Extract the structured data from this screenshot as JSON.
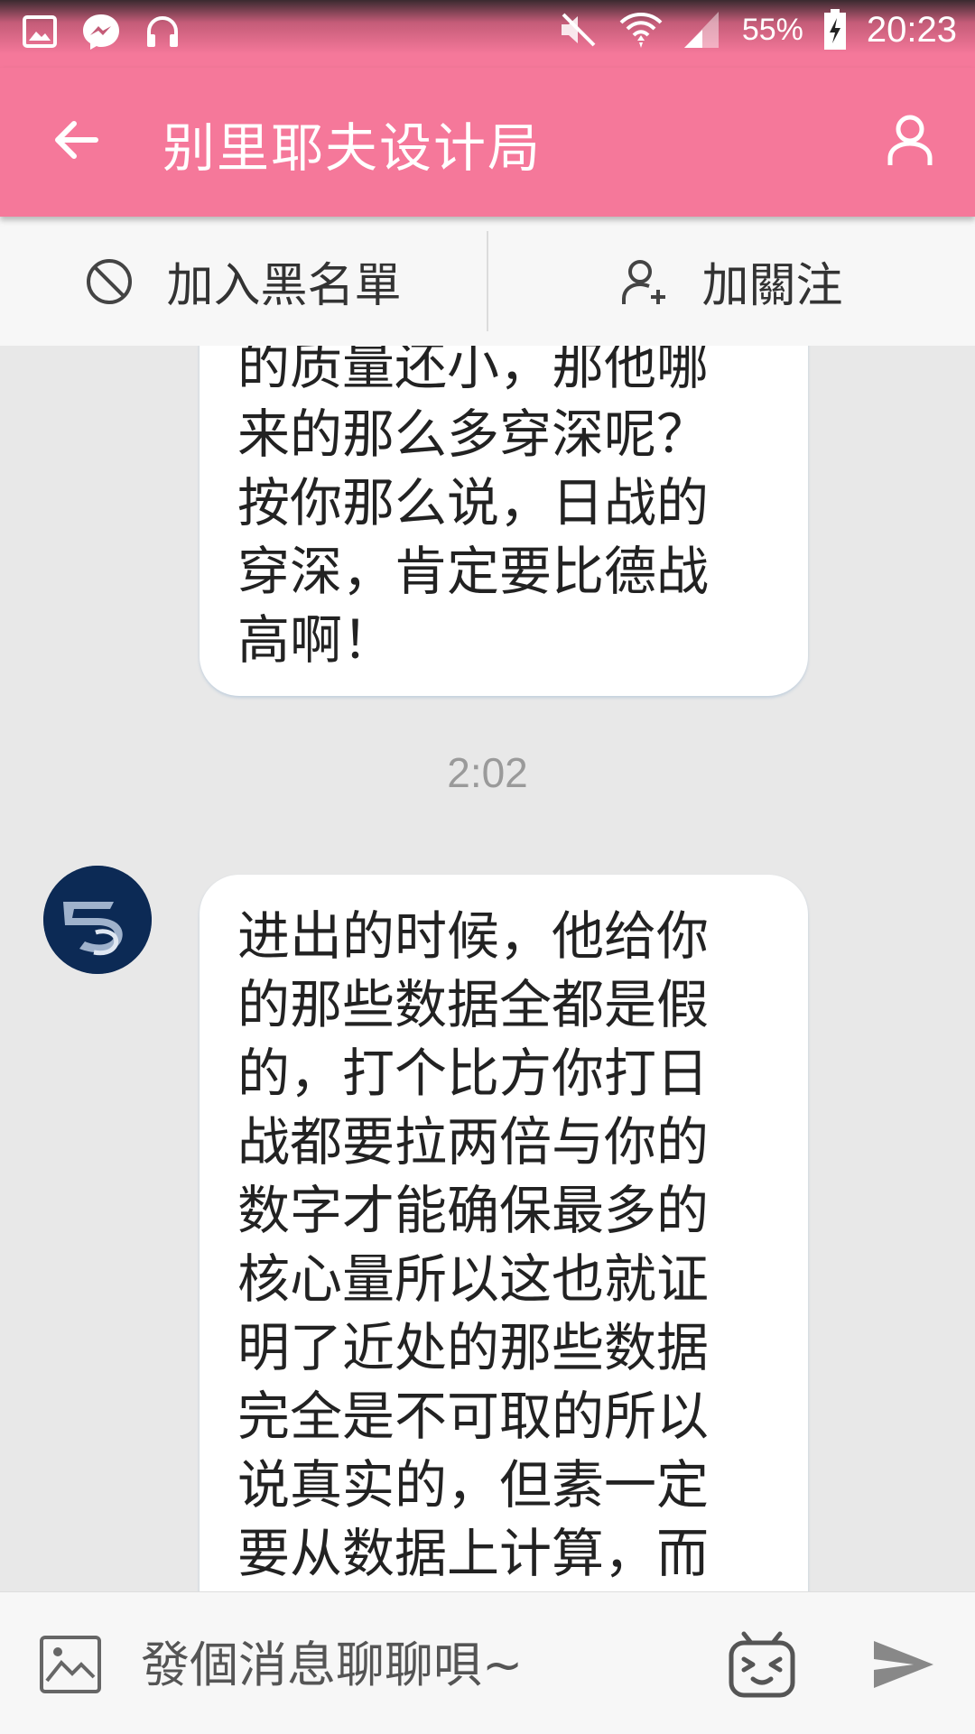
{
  "status_bar": {
    "battery_percent": "55%",
    "time": "20:23"
  },
  "header": {
    "title": "别里耶夫设计局"
  },
  "actions": {
    "blacklist_label": "加入黑名單",
    "follow_label": "加關注"
  },
  "messages": [
    {
      "text": "的质量还小，那他哪\n来的那么多穿深呢？\n按你那么说，日战的\n穿深，肯定要比德战\n高啊！"
    },
    {
      "time": "2:02"
    },
    {
      "text": "进出的时候，他给你\n的那些数据全都是假\n的，打个比方你打日\n战都要拉两倍与你的\n数字才能确保最多的\n核心量所以这也就证\n明了近处的那些数据\n完全是不可取的所以\n说真实的，但素一定\n要从数据上计算，而\n不是护那些瞄准镜上"
    }
  ],
  "input": {
    "placeholder": "發個消息聊聊唄~"
  },
  "colors": {
    "header": "#f5789a",
    "bubble": "#ffffff",
    "background": "#e8e8e8"
  }
}
